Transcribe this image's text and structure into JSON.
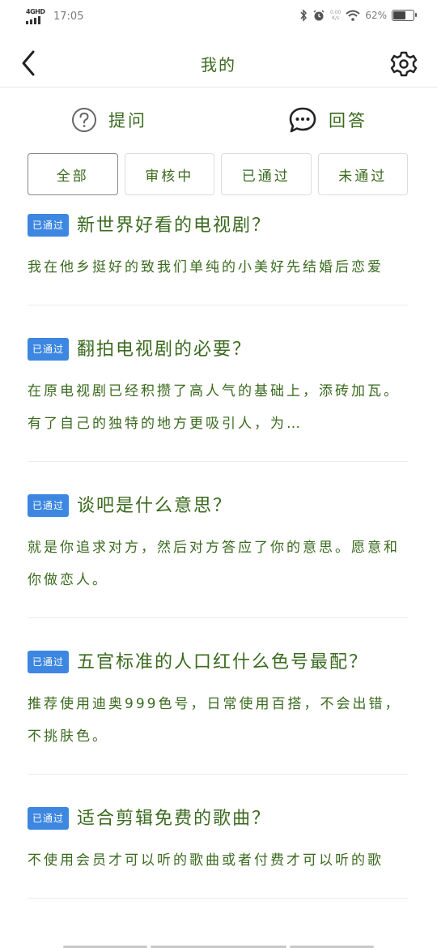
{
  "status_bar": {
    "network": "4GHD",
    "time": "17:05",
    "speed_top": "0.00",
    "speed_bottom": "K/s",
    "battery_pct": "62%",
    "battery_level": 0.62,
    "icons": [
      "bluetooth-icon",
      "alarm-icon",
      "wifi-icon",
      "battery-icon"
    ]
  },
  "header": {
    "title": "我的",
    "back_icon": "chevron-left-icon",
    "settings_icon": "gear-icon"
  },
  "actions": {
    "ask_label": "提问",
    "ask_icon": "question-circle-icon",
    "answer_label": "回答",
    "answer_icon": "chat-bubble-icon"
  },
  "tabs": [
    {
      "label": "全部",
      "active": true
    },
    {
      "label": "审核中",
      "active": false
    },
    {
      "label": "已通过",
      "active": false
    },
    {
      "label": "未通过",
      "active": false
    }
  ],
  "items": [
    {
      "badge": "已通过",
      "title": "新世界好看的电视剧？",
      "body": "我在他乡挺好的致我们单纯的小美好先结婚后恋爱"
    },
    {
      "badge": "已通过",
      "title": "翻拍电视剧的必要？",
      "body": "在原电视剧已经积攒了高人气的基础上，添砖加瓦。有了自己的独特的地方更吸引人，为…"
    },
    {
      "badge": "已通过",
      "title": "谈吧是什么意思？",
      "body": "就是你追求对方，然后对方答应了你的意思。愿意和你做恋人。"
    },
    {
      "badge": "已通过",
      "title": "五官标准的人口红什么色号最配？",
      "body": "推荐使用迪奥999色号，日常使用百搭，不会出错，不挑肤色。"
    },
    {
      "badge": "已通过",
      "title": "适合剪辑免费的歌曲？",
      "body": "不使用会员才可以听的歌曲或者付费才可以听的歌"
    }
  ],
  "colors": {
    "text_green": "#3a6a1e",
    "badge_blue": "#3d87e0",
    "divider": "#ececec"
  }
}
